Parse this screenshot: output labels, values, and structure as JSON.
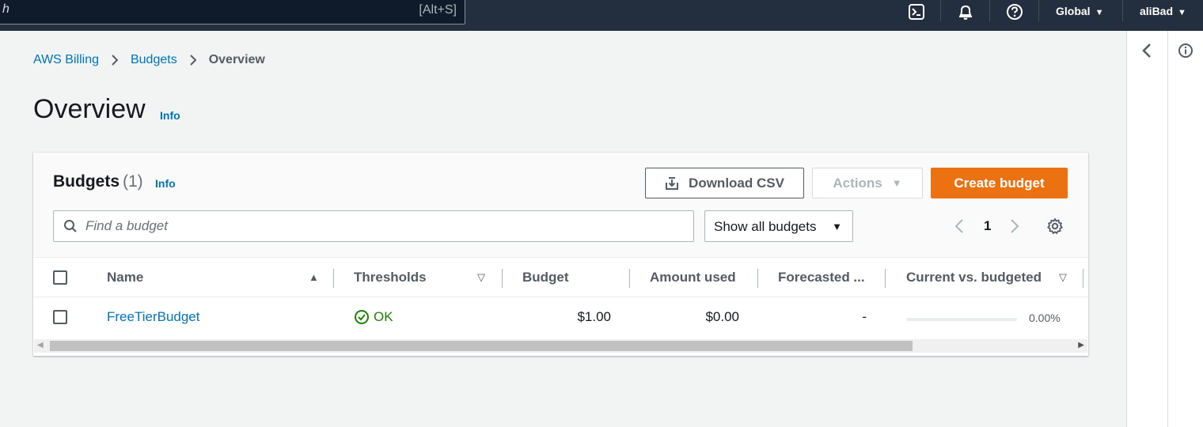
{
  "topnav": {
    "search_placeholder": "h",
    "search_shortcut": "[Alt+S]",
    "icons": [
      "cloudshell-icon",
      "bell-icon",
      "help-icon"
    ],
    "region": "Global",
    "account": "aliBad"
  },
  "breadcrumb": {
    "items": [
      "AWS Billing",
      "Budgets"
    ],
    "current": "Overview"
  },
  "page": {
    "title": "Overview",
    "info": "Info"
  },
  "budgets": {
    "title": "Budgets",
    "count": "(1)",
    "info": "Info",
    "download_label": "Download CSV",
    "actions_label": "Actions",
    "create_label": "Create budget",
    "filter_placeholder": "Find a budget",
    "select_value": "Show all budgets",
    "page_number": "1",
    "columns": [
      "Name",
      "Thresholds",
      "Budget",
      "Amount used",
      "Forecasted ...",
      "Current vs. budgeted"
    ],
    "rows": [
      {
        "name": "FreeTierBudget",
        "threshold": "OK",
        "budget": "$1.00",
        "amount_used": "$0.00",
        "forecasted": "-",
        "current_vs_budgeted": "0.00%",
        "progress_fraction": 0.0
      }
    ]
  },
  "colors": {
    "nav_bg": "#232f3e",
    "link": "#0073bb",
    "primary_button": "#ec7211",
    "ok_green": "#1d8102"
  }
}
